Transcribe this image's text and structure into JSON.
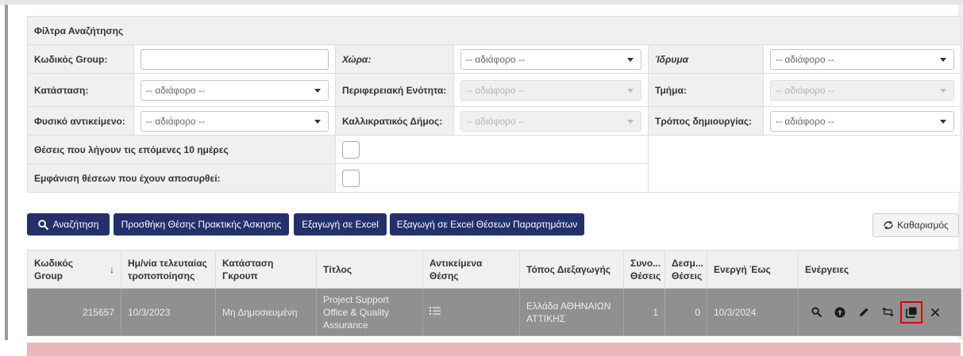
{
  "filters": {
    "title": "Φίλτρα Αναζήτησης",
    "group_code": {
      "label": "Κωδικός Group:",
      "value": ""
    },
    "country": {
      "label": "Χώρα:",
      "value": "-- αδιάφορο --"
    },
    "institution": {
      "label": "Ίδρυμα",
      "value": "-- αδιάφορο --"
    },
    "status": {
      "label": "Κατάσταση:",
      "value": "-- αδιάφορο --"
    },
    "region": {
      "label": "Περιφερειακή Ενότητα:",
      "value": "-- αδιάφορο --"
    },
    "department": {
      "label": "Τμήμα:",
      "value": "-- αδιάφορο --"
    },
    "physical_object": {
      "label": "Φυσικό αντικείμενο:",
      "value": "-- αδιάφορο --"
    },
    "municipality": {
      "label": "Καλλικρατικός Δήμος:",
      "value": "-- αδιάφορο --"
    },
    "creation_method": {
      "label": "Τρόπος δημιουργίας:",
      "value": "-- αδιάφορο --"
    },
    "expiring": {
      "label": "Θέσεις που λήγουν τις επόμενες 10 ημέρες",
      "checked": false
    },
    "withdrawn": {
      "label": "Εμφάνιση θέσεων που έχουν αποσυρθεί:",
      "checked": false
    }
  },
  "toolbar": {
    "search": "Αναζήτηση",
    "add_position": "Προσθήκη Θέσης Πρακτικής Άσκησης",
    "export_excel": "Εξαγωγή σε Excel",
    "export_excel_branches": "Εξαγωγή σε Excel Θέσεων Παραρτημάτων",
    "clear": "Καθαρισμός"
  },
  "grid": {
    "columns": [
      "Κωδικός Group",
      "Ημ/νία τελευταίας τροποποίησης",
      "Κατάσταση Γκρουπ",
      "Τίτλος",
      "Αντικείμενα Θέσης",
      "Τόπος Διεξαγωγής",
      "Συνο... Θέσεις",
      "Δεσμ... Θέσεις",
      "Ενεργή Έως",
      "Ενέργειες"
    ],
    "sort_indicator": "↓",
    "rows": [
      {
        "code": "215657",
        "modified": "10/3/2023",
        "status": "Μη Δημοσιευμένη",
        "title": "Project Support Office & Quality Assurance",
        "location": "Ελλάδα ΑΘΗΝΑΙΩΝ ΑΤΤΙΚΗΣ",
        "total": "1",
        "reserved": "0",
        "active_until": "10/3/2024"
      }
    ]
  },
  "colors": {
    "primary_button": "#24306c",
    "row_bg": "#909090",
    "highlight": "#e00000",
    "next_row": "#e7b9b9"
  },
  "icons": [
    "search-icon",
    "refresh-icon",
    "list-icon",
    "view-icon",
    "add-circle-icon",
    "edit-icon",
    "repost-icon",
    "copy-icon",
    "close-icon"
  ]
}
